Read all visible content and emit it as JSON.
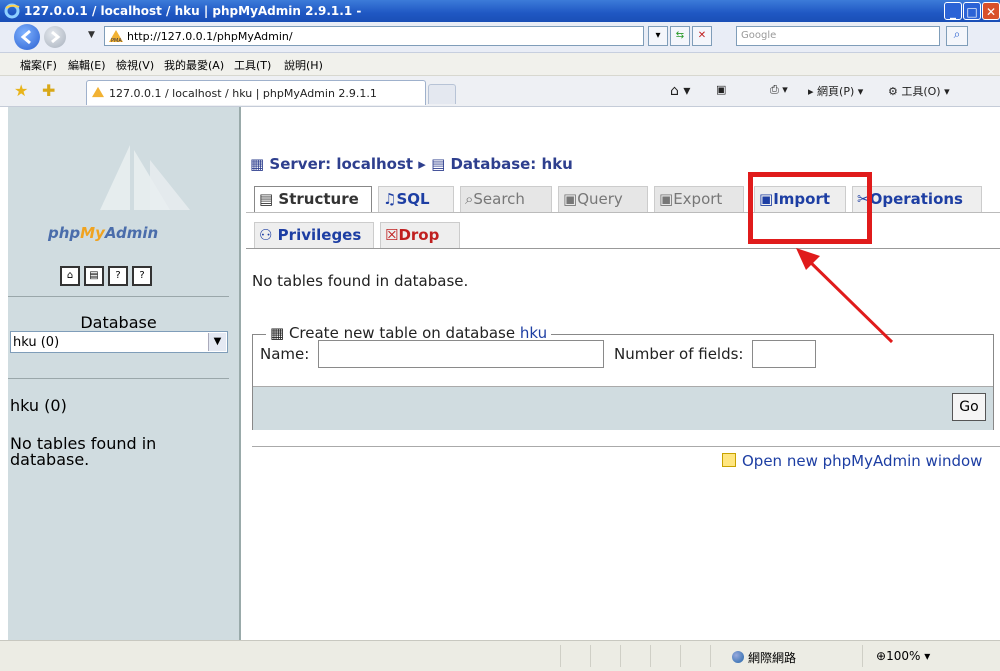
{
  "window": {
    "title": "127.0.0.1 / localhost / hku | phpMyAdmin 2.9.1.1 -",
    "controls": {
      "minimize": "_",
      "maximize": "□",
      "close": "✕"
    }
  },
  "browser": {
    "address": "http://127.0.0.1/phpMyAdmin/",
    "search_placeholder": "Google",
    "menu": [
      "檔案(F)",
      "編輯(E)",
      "檢視(V)",
      "我的最愛(A)",
      "工具(T)",
      "說明(H)"
    ],
    "tab_title": "127.0.0.1 / localhost / hku | phpMyAdmin 2.9.1.1",
    "toolbar_right": {
      "page": "網頁(P)",
      "tools": "工具(O)"
    }
  },
  "sidebar": {
    "logo": {
      "pre": "php",
      "mid": "My",
      "post": "Admin"
    },
    "database_label": "Database",
    "database_selected": "hku (0)",
    "db_name": "hku (0)",
    "no_tables": "No tables found in database."
  },
  "main": {
    "breadcrumb": {
      "server": "Server: localhost",
      "database": "Database: hku"
    },
    "tabs": [
      "Structure",
      "SQL",
      "Search",
      "Query",
      "Export",
      "Import",
      "Operations"
    ],
    "tabs_row2": [
      "Privileges",
      "Drop"
    ],
    "no_tables": "No tables found in database.",
    "create_table": {
      "legend_prefix": "Create new table on database",
      "db_link": "hku",
      "name_label": "Name:",
      "fields_label": "Number of fields:",
      "go_label": "Go"
    },
    "new_window_link": "Open new phpMyAdmin window"
  },
  "statusbar": {
    "zone": "網際網路",
    "zoom": "100%"
  },
  "colors": {
    "highlight": "#e01b1b",
    "sidebar_bg": "#d0dce0",
    "link": "#1d3ea3"
  }
}
